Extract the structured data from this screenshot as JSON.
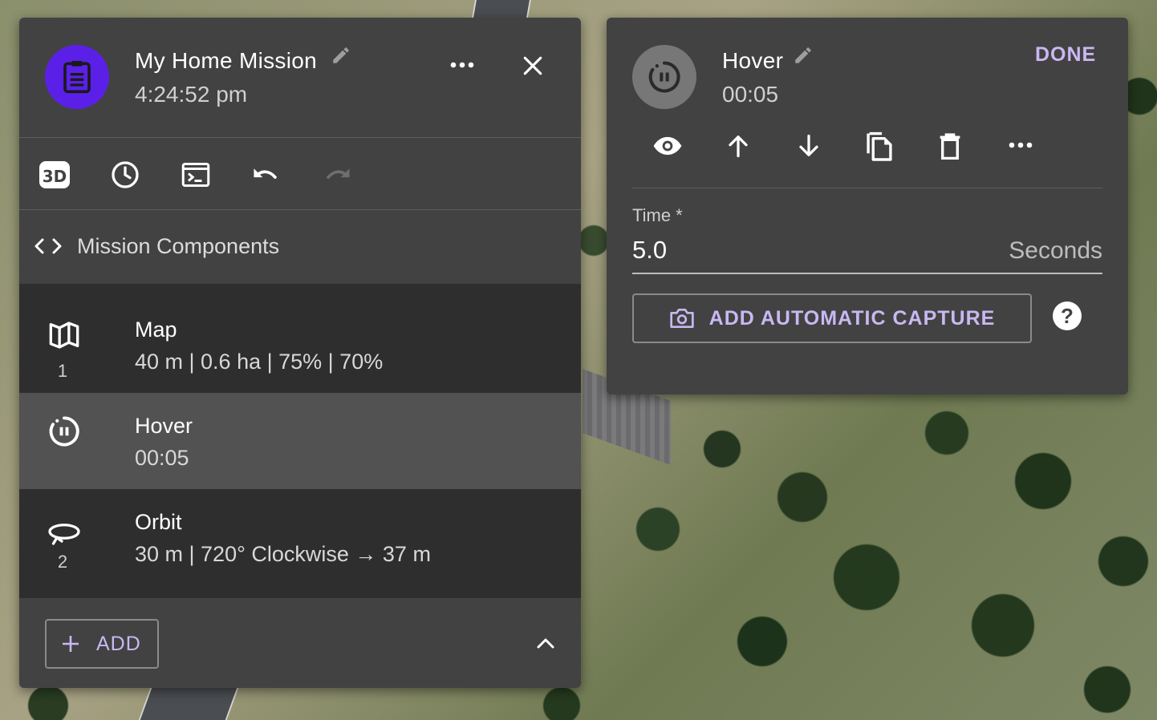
{
  "mission": {
    "title": "My Home Mission",
    "time": "4:24:52 pm",
    "avatar_color": "#5b20e8",
    "icons": {
      "avatar": "clipboard-icon",
      "edit": "pencil-icon",
      "more": "more-horizontal-icon",
      "close": "close-icon"
    }
  },
  "toolbar": {
    "buttons": [
      {
        "name": "3d-view-icon",
        "enabled": true
      },
      {
        "name": "clock-icon",
        "enabled": true
      },
      {
        "name": "terminal-icon",
        "enabled": true
      },
      {
        "name": "undo-icon",
        "enabled": true
      },
      {
        "name": "redo-icon",
        "enabled": false
      }
    ]
  },
  "components": {
    "header": "Mission Components",
    "items": [
      {
        "title": "Map",
        "subtitle": "40 m | 0.6 ha | 75% | 70%",
        "number": "1",
        "icon": "map-icon",
        "selected": false
      },
      {
        "title": "Hover",
        "subtitle": "00:05",
        "number": "",
        "icon": "hover-timer-icon",
        "selected": true
      },
      {
        "title": "Orbit",
        "subtitle": "30 m | 720° Clockwise → 37 m",
        "number": "2",
        "icon": "orbit-icon",
        "selected": false
      }
    ]
  },
  "footer": {
    "add_label": "ADD",
    "collapse_icon": "chevron-up-icon"
  },
  "step": {
    "title": "Hover",
    "duration": "00:05",
    "done_label": "DONE",
    "actions": [
      "eye-icon",
      "arrow-up-icon",
      "arrow-down-icon",
      "duplicate-icon",
      "delete-icon",
      "more-horizontal-icon"
    ],
    "time_field": {
      "label": "Time *",
      "value": "5.0",
      "suffix": "Seconds"
    },
    "capture_label": "ADD AUTOMATIC CAPTURE",
    "help_label": "?"
  },
  "colors": {
    "panel": "#424242",
    "list_bg": "#2e2e2e",
    "selected": "#525252",
    "accent_text": "#c9b8f2"
  }
}
